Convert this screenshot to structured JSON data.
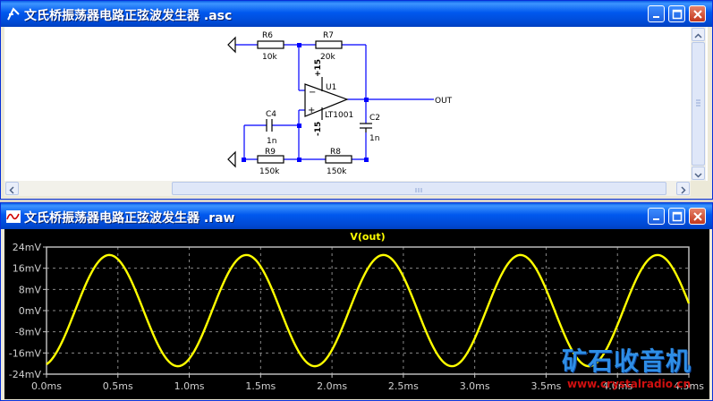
{
  "schematic_window": {
    "title": "文氏桥振荡器电路正弦波发生器 .asc",
    "components": {
      "r6": {
        "name": "R6",
        "value": "10k"
      },
      "r7": {
        "name": "R7",
        "value": "20k"
      },
      "r9": {
        "name": "R9",
        "value": "150k"
      },
      "r8": {
        "name": "R8",
        "value": "150k"
      },
      "c4": {
        "name": "C4",
        "value": "1n"
      },
      "c2": {
        "name": "C2",
        "value": "1n"
      },
      "u1": {
        "name": "U1",
        "value": "LT1001"
      }
    },
    "supply_pos": "+15",
    "supply_neg": "-15",
    "out_label": "OUT"
  },
  "waveform_window": {
    "title": "文氏桥振荡器电路正弦波发生器 .raw"
  },
  "watermark": {
    "brand": "矿石收音机",
    "url": "www.crystalradio.cn"
  },
  "chart_data": {
    "type": "line",
    "title": "V(out)",
    "series": [
      {
        "name": "V(out)",
        "color": "#ffff00",
        "amplitude_mv": 21,
        "period_ms": 0.96,
        "phase_ms": 0.2,
        "x_start_ms": 0.0,
        "x_end_ms": 4.5
      }
    ],
    "x_ticks": [
      "0.0ms",
      "0.5ms",
      "1.0ms",
      "1.5ms",
      "2.0ms",
      "2.5ms",
      "3.0ms",
      "3.5ms",
      "4.0ms",
      "4.5ms"
    ],
    "y_ticks": [
      "24mV",
      "16mV",
      "8mV",
      "0mV",
      "-8mV",
      "-16mV",
      "-24mV"
    ],
    "xlim": [
      0,
      4.5
    ],
    "ylim": [
      -24,
      24
    ],
    "grid": true,
    "background": "#000000"
  }
}
